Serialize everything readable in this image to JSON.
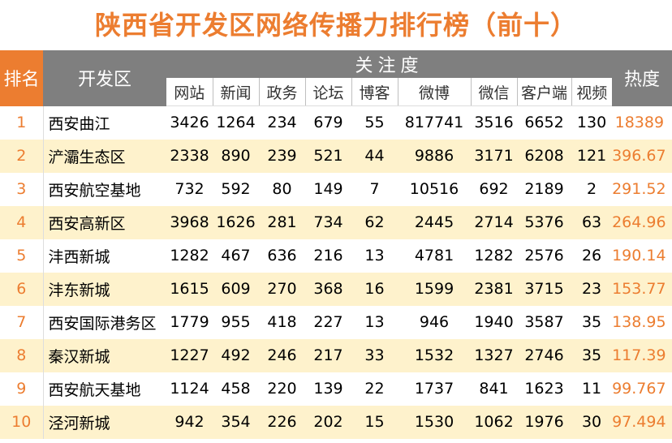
{
  "title": "陕西省开发区网络传播力排行榜（前十）",
  "header": {
    "rank": "排名",
    "name": "开发区",
    "attention": "关注度",
    "heat": "热度",
    "columns": [
      "网站",
      "新闻",
      "政务",
      "论坛",
      "博客",
      "微博",
      "微信",
      "客户端",
      "视频"
    ]
  },
  "colors": {
    "accent": "#ec7d30",
    "header_gray": "#7f7f7f",
    "stripe": "#fef2cc"
  },
  "chart_data": {
    "type": "table",
    "columns": [
      "排名",
      "开发区",
      "网站",
      "新闻",
      "政务",
      "论坛",
      "博客",
      "微博",
      "微信",
      "客户端",
      "视频",
      "热度"
    ],
    "rows": [
      {
        "rank": "1",
        "name": "西安曲江",
        "values": [
          "3426",
          "1264",
          "234",
          "679",
          "55",
          "817741",
          "3516",
          "6652",
          "130"
        ],
        "heat": "18389"
      },
      {
        "rank": "2",
        "name": "浐灞生态区",
        "values": [
          "2338",
          "890",
          "239",
          "521",
          "44",
          "9886",
          "3171",
          "6208",
          "121"
        ],
        "heat": "396.67"
      },
      {
        "rank": "3",
        "name": "西安航空基地",
        "values": [
          "732",
          "592",
          "80",
          "149",
          "7",
          "10516",
          "692",
          "2189",
          "2"
        ],
        "heat": "291.52"
      },
      {
        "rank": "4",
        "name": "西安高新区",
        "values": [
          "3968",
          "1626",
          "281",
          "734",
          "62",
          "2445",
          "2714",
          "5376",
          "63"
        ],
        "heat": "264.96"
      },
      {
        "rank": "5",
        "name": "沣西新城",
        "values": [
          "1282",
          "467",
          "636",
          "216",
          "13",
          "4781",
          "1282",
          "2576",
          "26"
        ],
        "heat": "190.14"
      },
      {
        "rank": "6",
        "name": "沣东新城",
        "values": [
          "1615",
          "609",
          "270",
          "368",
          "16",
          "1599",
          "2381",
          "3715",
          "23"
        ],
        "heat": "153.77"
      },
      {
        "rank": "7",
        "name": "西安国际港务区",
        "values": [
          "1779",
          "955",
          "418",
          "227",
          "13",
          "946",
          "1940",
          "3587",
          "35"
        ],
        "heat": "138.95"
      },
      {
        "rank": "8",
        "name": "秦汉新城",
        "values": [
          "1227",
          "492",
          "246",
          "217",
          "33",
          "1532",
          "1327",
          "2746",
          "35"
        ],
        "heat": "117.39"
      },
      {
        "rank": "9",
        "name": "西安航天基地",
        "values": [
          "1124",
          "458",
          "220",
          "139",
          "22",
          "1737",
          "841",
          "1623",
          "11"
        ],
        "heat": "99.767"
      },
      {
        "rank": "10",
        "name": "泾河新城",
        "values": [
          "942",
          "354",
          "226",
          "202",
          "15",
          "1530",
          "1062",
          "1976",
          "30"
        ],
        "heat": "97.494"
      }
    ]
  }
}
